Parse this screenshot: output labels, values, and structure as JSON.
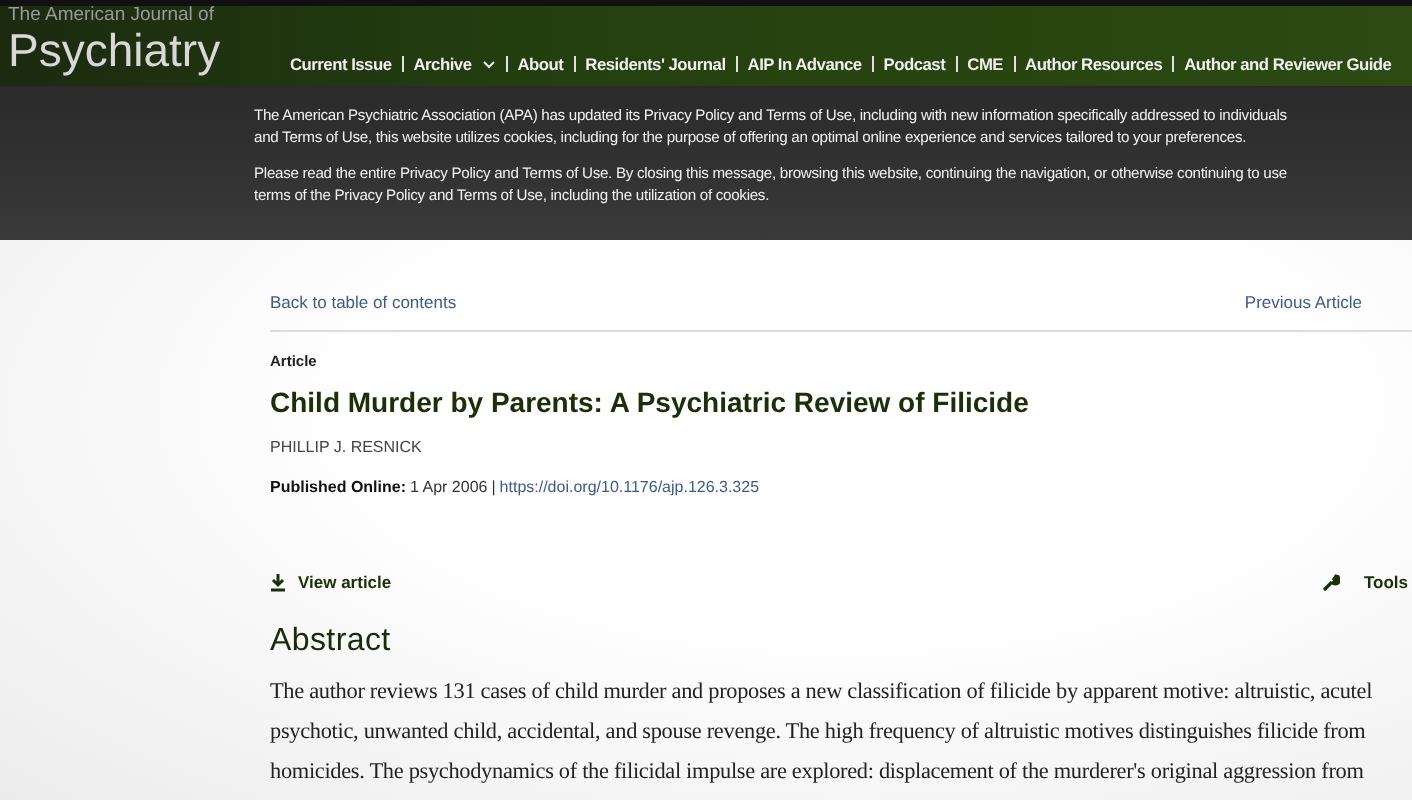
{
  "header": {
    "journal_prefix": "The American Journal of",
    "journal_name": "Psychiatry",
    "nav": [
      {
        "label": "Current Issue",
        "dropdown": false
      },
      {
        "label": "Archive",
        "dropdown": true
      },
      {
        "label": "About",
        "dropdown": false
      },
      {
        "label": "Residents' Journal",
        "dropdown": false
      },
      {
        "label": "AIP In Advance",
        "dropdown": false
      },
      {
        "label": "Podcast",
        "dropdown": false
      },
      {
        "label": "CME",
        "dropdown": false
      },
      {
        "label": "Author Resources",
        "dropdown": false
      },
      {
        "label": "Author and Reviewer Guide",
        "dropdown": false
      }
    ]
  },
  "cookie_notice": {
    "paragraphs": [
      [
        "The American Psychiatric Association (APA) has updated its Privacy Policy and Terms of Use, including with new information specifically addressed to individuals",
        "and Terms of Use, this website utilizes cookies, including for the purpose of offering an optimal online experience and services tailored to your preferences."
      ],
      [
        "Please read the entire Privacy Policy and Terms of Use. By closing this message, browsing this website, continuing the navigation, or otherwise continuing to use",
        "terms of the Privacy Policy and Terms of Use, including the utilization of cookies."
      ]
    ]
  },
  "article_nav": {
    "back": "Back to table of contents",
    "previous": "Previous Article"
  },
  "article": {
    "type": "Article",
    "title": "Child Murder by Parents: A Psychiatric Review of Filicide",
    "author": "PHILLIP J. RESNICK",
    "published_label": "Published Online:",
    "published_date": "1 Apr 2006",
    "separator": "|",
    "doi": "https://doi.org/10.1176/ajp.126.3.325"
  },
  "actions": {
    "view": "View article",
    "tools": "Tools"
  },
  "abstract": {
    "heading": "Abstract",
    "lines": [
      "The author reviews 131 cases of child murder and proposes a new classification of filicide by apparent motive: altruistic, acutel",
      "psychotic, unwanted child, accidental, and spouse revenge. The high frequency of altruistic motives distinguishes filicide from",
      "homicides. The psychodynamics of the filicidal impulse are explored: displacement of the murderer's original aggression from"
    ]
  }
}
